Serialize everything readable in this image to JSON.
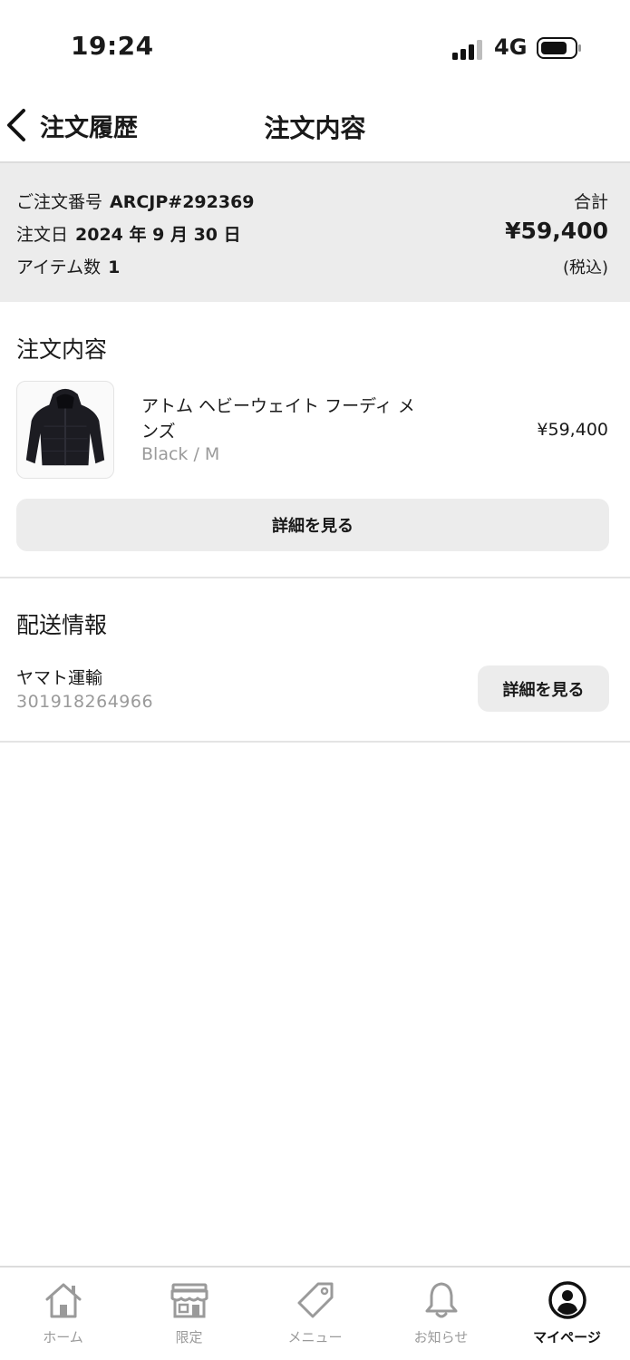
{
  "status_bar": {
    "time": "19:24",
    "network": "4G"
  },
  "nav": {
    "back_label": "注文履歴",
    "title": "注文内容"
  },
  "summary": {
    "order_number_label": "ご注文番号",
    "order_number": "ARCJP#292369",
    "order_date_label": "注文日",
    "order_date": "2024 年 9 月 30 日",
    "item_count_label": "アイテム数",
    "item_count": "1",
    "total_label": "合計",
    "total_amount": "¥59,400",
    "tax_note": "(税込)"
  },
  "order_section": {
    "title": "注文内容",
    "item": {
      "name": "アトム ヘビーウェイト フーディ メンズ",
      "variant": "Black / M",
      "price": "¥59,400"
    },
    "details_button": "詳細を見る"
  },
  "shipping_section": {
    "title": "配送情報",
    "carrier": "ヤマト運輸",
    "tracking_number": "301918264966",
    "details_button": "詳細を見る"
  },
  "tab_bar": {
    "tabs": [
      {
        "label": "ホーム",
        "icon": "home-icon"
      },
      {
        "label": "限定",
        "icon": "store-icon"
      },
      {
        "label": "メニュー",
        "icon": "tag-icon"
      },
      {
        "label": "お知らせ",
        "icon": "bell-icon"
      },
      {
        "label": "マイページ",
        "icon": "user-circle-icon"
      }
    ],
    "active_tab": "マイページ"
  }
}
